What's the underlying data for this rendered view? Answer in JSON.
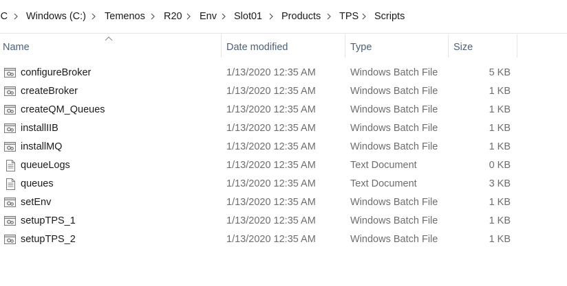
{
  "breadcrumb": {
    "items": [
      "PC",
      "Windows (C:)",
      "Temenos",
      "R20",
      "Env",
      "Slot01",
      "Products",
      "TPS",
      "Scripts"
    ]
  },
  "columns": {
    "name": "Name",
    "date_modified": "Date modified",
    "type": "Type",
    "size": "Size",
    "sorted_by": "Name"
  },
  "files": [
    {
      "name": "configureBroker",
      "date": "1/13/2020 12:35 AM",
      "type": "Windows Batch File",
      "size": "5 KB",
      "icon": "batch-file-icon"
    },
    {
      "name": "createBroker",
      "date": "1/13/2020 12:35 AM",
      "type": "Windows Batch File",
      "size": "1 KB",
      "icon": "batch-file-icon"
    },
    {
      "name": "createQM_Queues",
      "date": "1/13/2020 12:35 AM",
      "type": "Windows Batch File",
      "size": "1 KB",
      "icon": "batch-file-icon"
    },
    {
      "name": "installIIB",
      "date": "1/13/2020 12:35 AM",
      "type": "Windows Batch File",
      "size": "1 KB",
      "icon": "batch-file-icon"
    },
    {
      "name": "installMQ",
      "date": "1/13/2020 12:35 AM",
      "type": "Windows Batch File",
      "size": "1 KB",
      "icon": "batch-file-icon"
    },
    {
      "name": "queueLogs",
      "date": "1/13/2020 12:35 AM",
      "type": "Text Document",
      "size": "0 KB",
      "icon": "text-file-icon"
    },
    {
      "name": "queues",
      "date": "1/13/2020 12:35 AM",
      "type": "Text Document",
      "size": "3 KB",
      "icon": "text-file-icon"
    },
    {
      "name": "setEnv",
      "date": "1/13/2020 12:35 AM",
      "type": "Windows Batch File",
      "size": "1 KB",
      "icon": "batch-file-icon"
    },
    {
      "name": "setupTPS_1",
      "date": "1/13/2020 12:35 AM",
      "type": "Windows Batch File",
      "size": "1 KB",
      "icon": "batch-file-icon"
    },
    {
      "name": "setupTPS_2",
      "date": "1/13/2020 12:35 AM",
      "type": "Windows Batch File",
      "size": "1 KB",
      "icon": "batch-file-icon"
    }
  ],
  "colors": {
    "header_text": "#4c607a",
    "secondary_text": "#6d6d6d",
    "separator": "#e5e5e5"
  }
}
